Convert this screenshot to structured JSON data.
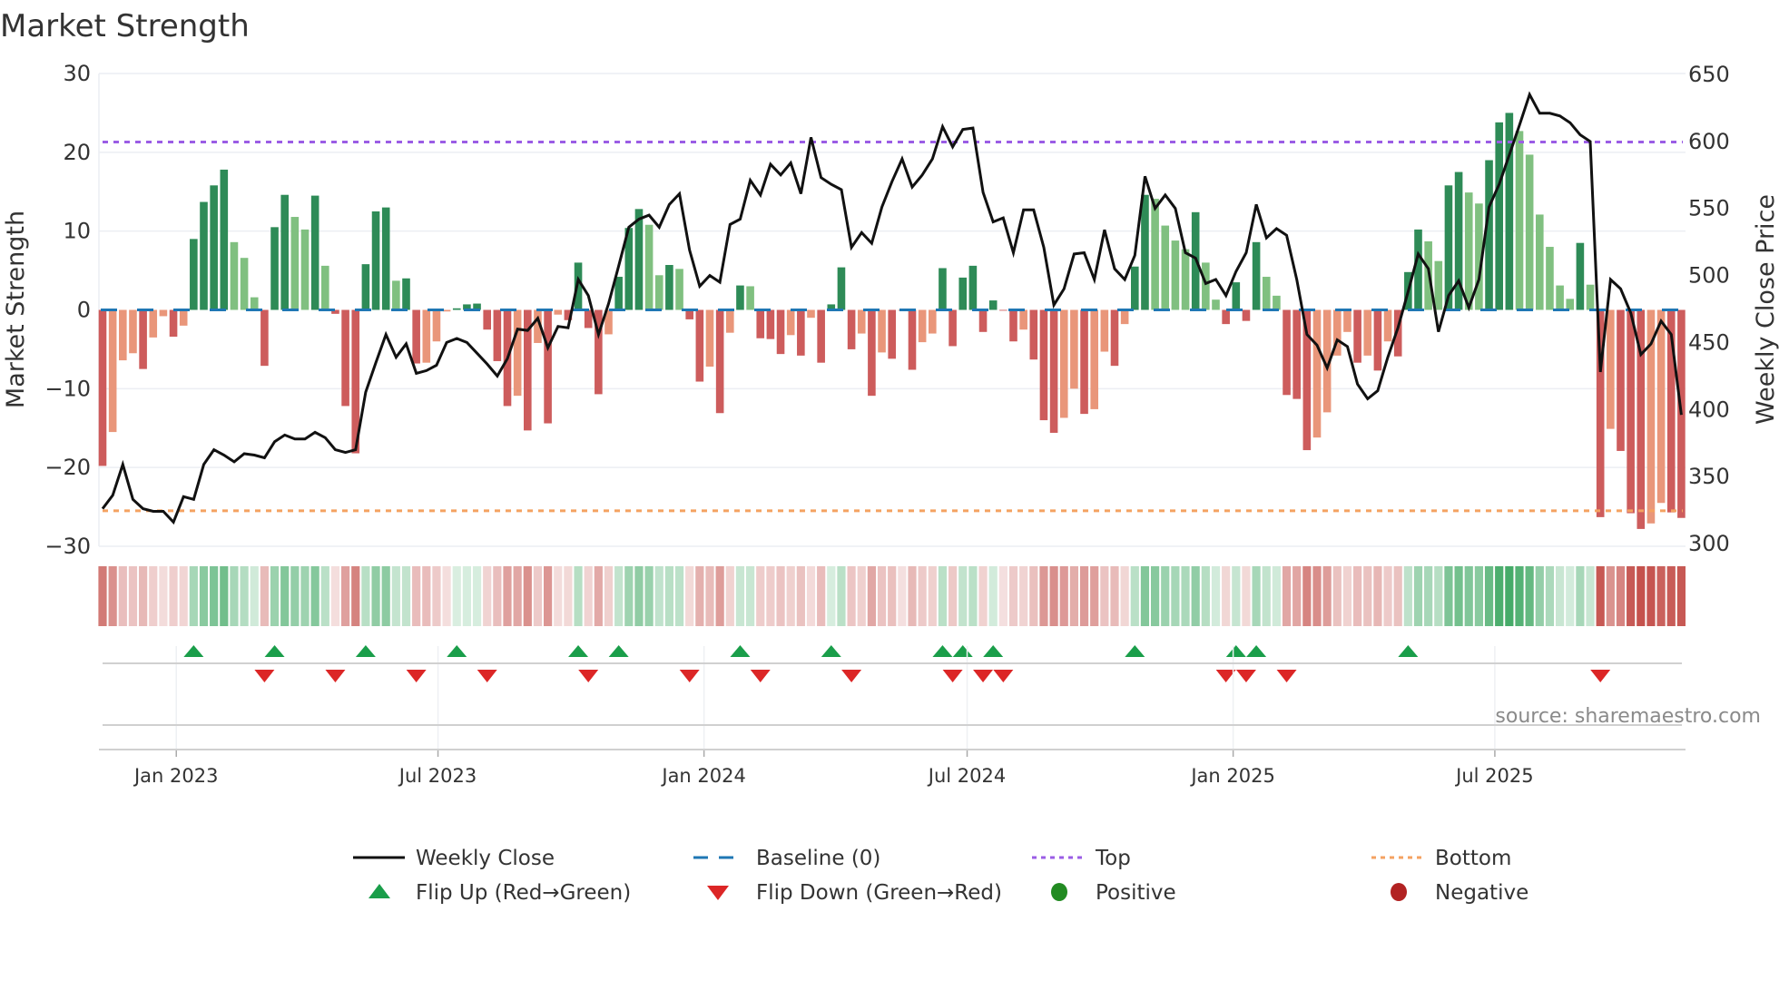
{
  "title": "Market Strength",
  "source": "source: sharemaestro.com",
  "chart_data": {
    "type": "bar+line",
    "title": "Market Strength",
    "start_date": "2022-11-11",
    "interval_days": 7,
    "strength": [
      -19.8,
      -15.5,
      -6.4,
      -5.5,
      -7.5,
      -3.5,
      -0.8,
      -3.4,
      -2.0,
      9.0,
      13.7,
      15.8,
      17.8,
      8.6,
      6.6,
      1.6,
      -7.1,
      10.5,
      14.6,
      11.8,
      10.2,
      14.5,
      5.6,
      -0.5,
      -12.2,
      -18.2,
      5.8,
      12.5,
      13.0,
      3.7,
      4.0,
      -6.8,
      -6.7,
      -4.0,
      -0.2,
      0.2,
      0.7,
      0.8,
      -2.5,
      -6.5,
      -12.2,
      -10.9,
      -15.3,
      -4.2,
      -14.4,
      -0.6,
      -1.3,
      6.0,
      -2.3,
      -10.7,
      -3.1,
      4.2,
      10.4,
      12.8,
      10.8,
      4.4,
      5.7,
      5.2,
      -1.2,
      -9.1,
      -7.2,
      -13.1,
      -2.9,
      3.1,
      3.0,
      -3.6,
      -3.7,
      -5.6,
      -3.2,
      -5.8,
      -1.0,
      -6.7,
      0.7,
      5.4,
      -5.0,
      -3.0,
      -10.9,
      -5.4,
      -6.2,
      -0.1,
      -7.6,
      -4.1,
      -3.0,
      5.3,
      -4.6,
      4.1,
      5.6,
      -2.8,
      1.2,
      -0.1,
      -4.0,
      -2.5,
      -6.3,
      -14.0,
      -15.6,
      -13.7,
      -10.0,
      -13.2,
      -12.6,
      -5.3,
      -7.1,
      -1.8,
      5.5,
      14.6,
      14.1,
      10.7,
      8.8,
      7.7,
      12.4,
      6.0,
      1.3,
      -1.8,
      3.5,
      -1.4,
      8.6,
      4.2,
      1.8,
      -10.8,
      -11.3,
      -17.8,
      -16.2,
      -13.0,
      -5.8,
      -2.8,
      -6.7,
      -5.8,
      -7.7,
      -4.0,
      -5.9,
      4.8,
      10.2,
      8.7,
      6.2,
      15.8,
      17.5,
      14.9,
      13.5,
      19.0,
      23.8,
      25.0,
      22.7,
      19.7,
      12.1,
      8.0,
      3.1,
      1.4,
      8.5,
      3.2,
      -26.3,
      -15.1,
      -17.9,
      -25.8,
      -27.8,
      -27.1,
      -24.5,
      -25.7,
      -26.4
    ],
    "close": [
      326,
      336,
      359,
      333,
      326,
      324,
      324,
      316,
      335,
      333,
      359,
      370,
      366,
      361,
      367,
      366,
      364,
      376,
      381,
      378,
      378,
      383,
      379,
      370,
      368,
      370,
      413,
      435,
      456,
      439,
      449,
      427,
      429,
      433,
      450,
      453,
      450,
      442,
      434,
      425,
      438,
      460,
      459,
      468,
      446,
      462,
      461,
      497,
      485,
      456,
      479,
      507,
      536,
      542,
      545,
      536,
      553,
      561,
      519,
      492,
      500,
      495,
      538,
      542,
      571,
      560,
      583,
      575,
      584,
      561,
      603,
      573,
      568,
      564,
      521,
      532,
      524,
      551,
      570,
      587,
      566,
      575,
      587,
      611,
      596,
      609,
      610,
      562,
      540,
      543,
      517,
      549,
      549,
      521,
      478,
      490,
      516,
      517,
      497,
      534,
      505,
      497,
      515,
      574,
      550,
      560,
      550,
      517,
      513,
      494,
      497,
      485,
      503,
      517,
      553,
      528,
      535,
      530,
      497,
      456,
      448,
      431,
      452,
      447,
      419,
      408,
      414,
      439,
      461,
      488,
      516,
      505,
      458,
      485,
      496,
      476,
      497,
      551,
      568,
      590,
      612,
      635,
      621,
      621,
      619,
      614,
      605,
      600,
      428,
      497,
      490,
      472,
      441,
      449,
      466,
      456,
      396
    ],
    "top_level": 21.3,
    "bottom_level": -25.5,
    "baseline": 0,
    "left_axis": {
      "label": "Market Strength",
      "range": [
        -30,
        30
      ],
      "ticks": [
        30,
        20,
        10,
        0,
        -10,
        -20,
        -30
      ],
      "tick_labels": [
        "30",
        "20",
        "10",
        "0",
        "−10",
        "−20",
        "−30"
      ]
    },
    "right_axis": {
      "label": "Weekly Close Price",
      "range": [
        300,
        650
      ],
      "ticks": [
        650,
        600,
        550,
        500,
        450,
        400,
        350,
        300
      ],
      "tick_labels": [
        "650",
        "600",
        "550",
        "500",
        "450",
        "400",
        "350",
        "300"
      ]
    },
    "x_ticks": [
      {
        "label": "Jan 2023",
        "date": "2023-01-01"
      },
      {
        "label": "Jul 2023",
        "date": "2023-07-01"
      },
      {
        "label": "Jan 2024",
        "date": "2024-01-01"
      },
      {
        "label": "Jul 2024",
        "date": "2024-07-01"
      },
      {
        "label": "Jan 2025",
        "date": "2025-01-01"
      },
      {
        "label": "Jul 2025",
        "date": "2025-07-01"
      }
    ],
    "grid": true,
    "legend_placement": "bottom",
    "legend": [
      {
        "label": "Weekly Close"
      },
      {
        "label": "Baseline (0)"
      },
      {
        "label": "Top"
      },
      {
        "label": "Bottom"
      },
      {
        "label": "Flip Up (Red→Green)"
      },
      {
        "label": "Flip Down (Green→Red)"
      },
      {
        "label": "Positive"
      },
      {
        "label": "Negative"
      }
    ],
    "colors": {
      "pos_strong": "#2e8b57",
      "pos_weak": "#80c080",
      "neg_strong": "#cd5c5c",
      "neg_weak": "#e9967a",
      "close_line": "#111111",
      "baseline": "#1f77b4",
      "top": "#9b5de5",
      "bottom": "#f4a261",
      "flip_up": "#1a9e4a",
      "flip_down": "#dc2626",
      "positive": "#228b22",
      "negative": "#b22222",
      "strip_pos": "#34a35a",
      "strip_neg": "#c4504b"
    }
  }
}
